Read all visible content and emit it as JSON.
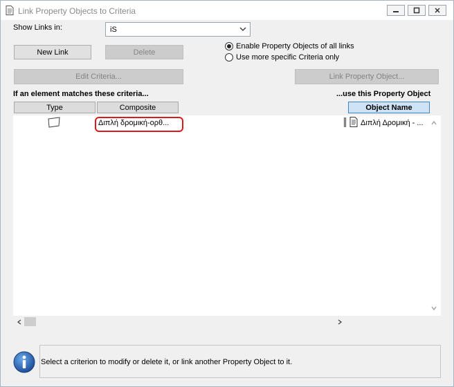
{
  "window": {
    "title": "Link Property Objects to Criteria"
  },
  "show_links": {
    "label": "Show Links in:",
    "selected": "iS"
  },
  "buttons": {
    "new_link": "New Link",
    "delete": "Delete",
    "edit_criteria": "Edit Criteria...",
    "link_property_object": "Link Property Object..."
  },
  "options": {
    "enable_all": "Enable Property Objects of all links",
    "more_specific": "Use more specific Criteria only",
    "selected": "enable_all"
  },
  "headers": {
    "left": "If an element matches these criteria...",
    "right": "...use this Property Object"
  },
  "columns": {
    "type": "Type",
    "composite": "Composite",
    "object_name": "Object Name"
  },
  "rows": [
    {
      "type_icon": "slab-shape-icon",
      "composite": "Διπλή δρομική-ορθ...",
      "object_icon": "document-icon",
      "object_name": "Διπλή Δρομική - ..."
    }
  ],
  "status": {
    "icon": "info-icon",
    "message": "Select a criterion to modify or delete it, or link another Property Object to it."
  },
  "colors": {
    "highlight_outline": "#e0161b",
    "info_icon_blue": "#1f63b0"
  }
}
